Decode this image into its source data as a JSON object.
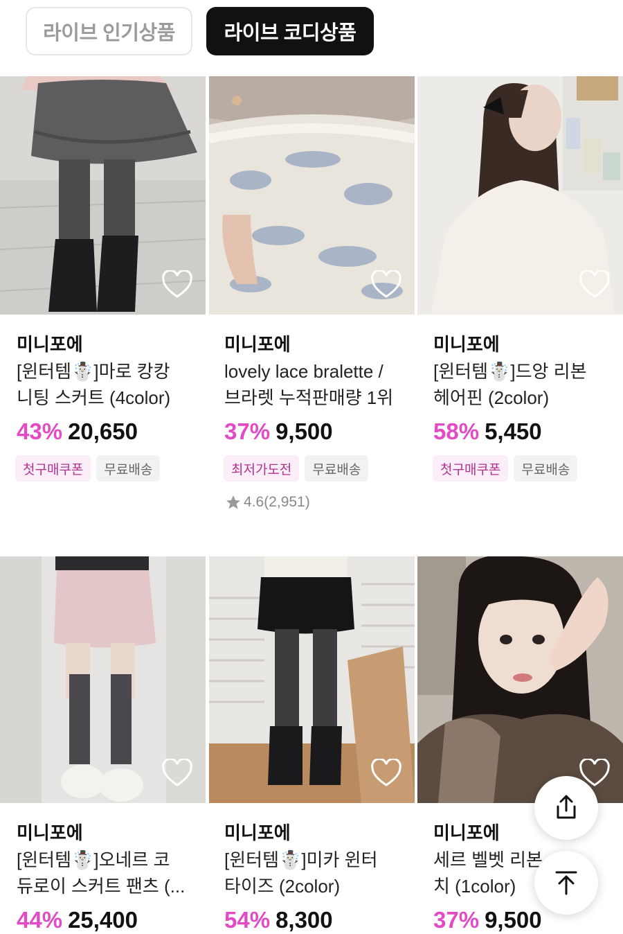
{
  "tabs": [
    {
      "label": "라이브 인기상품",
      "active": false
    },
    {
      "label": "라이브 코디상품",
      "active": true
    }
  ],
  "products": [
    {
      "brand": "미니포에",
      "title_line1": "[윈터템☃️]마로 캉캉",
      "title_line2": "니팅 스커트 (4color)",
      "discount": "43%",
      "price": "20,650",
      "badges": [
        "첫구매쿠폰",
        "무료배송"
      ],
      "rating": ""
    },
    {
      "brand": "미니포에",
      "title_line1": "lovely lace bralette /",
      "title_line2": "브라렛 누적판매량 1위",
      "discount": "37%",
      "price": "9,500",
      "badges": [
        "최저가도전",
        "무료배송"
      ],
      "rating": "4.6(2,951)"
    },
    {
      "brand": "미니포에",
      "title_line1": "[윈터템☃️]드앙 리본",
      "title_line2": "헤어핀 (2color)",
      "discount": "58%",
      "price": "5,450",
      "badges": [
        "첫구매쿠폰",
        "무료배송"
      ],
      "rating": ""
    },
    {
      "brand": "미니포에",
      "title_line1": "[윈터템☃️]오네르 코",
      "title_line2": "듀로이 스커트 팬츠 (...",
      "discount": "44%",
      "price": "25,400",
      "badges": [],
      "rating": ""
    },
    {
      "brand": "미니포에",
      "title_line1": "[윈터템☃️]미카 윈터",
      "title_line2": "타이즈 (2color)",
      "discount": "54%",
      "price": "8,300",
      "badges": [],
      "rating": ""
    },
    {
      "brand": "미니포에",
      "title_line1": "세르 벨벳 리본 ",
      "title_line2": "치 (1color)",
      "discount": "37%",
      "price": "9,500",
      "badges": [],
      "rating": ""
    }
  ],
  "colors": {
    "discount": "#e24bc4",
    "active_tab": "#111111",
    "badge_pink_text": "#b1338f"
  },
  "icons": {
    "wishlist": "heart-outline-icon",
    "share": "share-icon",
    "scroll_top": "arrow-up-to-top-icon",
    "star": "star-icon"
  }
}
